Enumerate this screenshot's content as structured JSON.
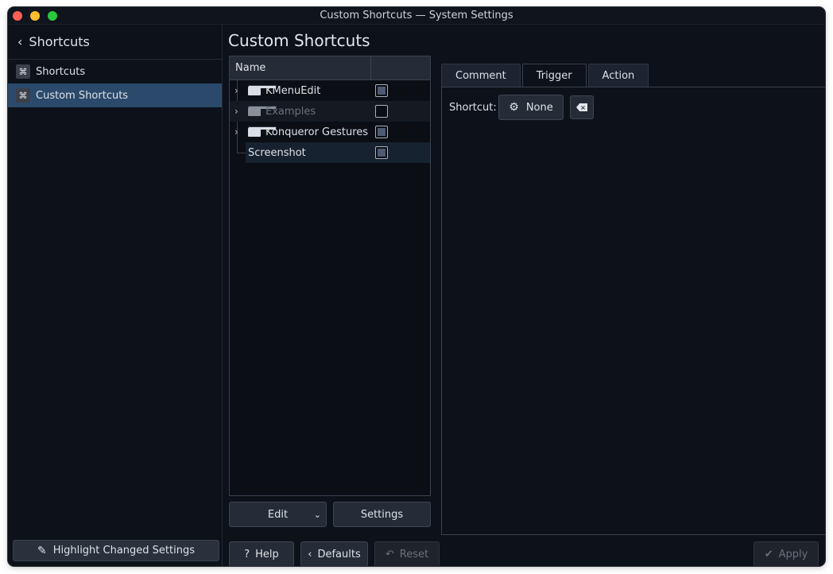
{
  "window": {
    "title": "Custom Shortcuts — System Settings"
  },
  "sidebar": {
    "back_label": "Shortcuts",
    "items": [
      {
        "label": "Shortcuts",
        "icon": "command-key-icon",
        "selected": false
      },
      {
        "label": "Custom Shortcuts",
        "icon": "command-key-icon",
        "selected": true
      }
    ],
    "highlight_button": "Highlight Changed Settings"
  },
  "main": {
    "page_title": "Custom Shortcuts",
    "tree": {
      "header": "Name",
      "rows": [
        {
          "label": "KMenuEdit",
          "type": "folder",
          "expandable": true,
          "checked": true,
          "enabled": true
        },
        {
          "label": "Examples",
          "type": "folder",
          "expandable": true,
          "checked": false,
          "enabled": false
        },
        {
          "label": "Konqueror Gestures",
          "type": "folder",
          "expandable": true,
          "checked": true,
          "enabled": true
        },
        {
          "label": "Screenshot",
          "type": "item",
          "expandable": false,
          "checked": true,
          "enabled": true,
          "selected": true
        }
      ]
    },
    "edit_button": "Edit",
    "settings_button": "Settings",
    "tabs": [
      {
        "label": "Comment",
        "active": false
      },
      {
        "label": "Trigger",
        "active": true
      },
      {
        "label": "Action",
        "active": false
      }
    ],
    "trigger": {
      "shortcut_label": "Shortcut:",
      "shortcut_value": "None"
    }
  },
  "footer": {
    "help": "Help",
    "defaults": "Defaults",
    "reset": "Reset",
    "apply": "Apply"
  },
  "colors": {
    "background": "#0d111a",
    "selection": "#2b4a6b",
    "button": "#262c37"
  }
}
